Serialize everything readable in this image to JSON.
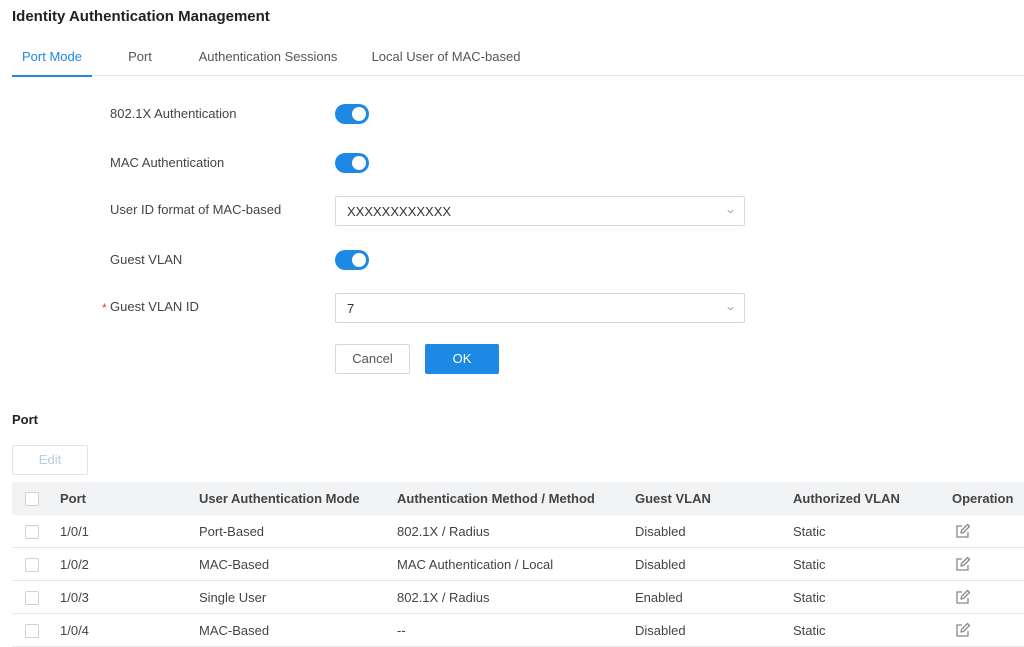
{
  "page": {
    "title": "Identity Authentication Management"
  },
  "tabs": [
    {
      "label": "Port Mode",
      "active": true
    },
    {
      "label": "Port"
    },
    {
      "label": "Authentication Sessions"
    },
    {
      "label": "Local User of MAC-based"
    }
  ],
  "form": {
    "dot1x": {
      "label": "802.1X Authentication",
      "enabled": true
    },
    "mac_auth": {
      "label": "MAC Authentication",
      "enabled": true
    },
    "user_id_format": {
      "label": "User ID format of MAC-based",
      "value": "XXXXXXXXXXXX"
    },
    "guest_vlan": {
      "label": "Guest VLAN",
      "enabled": true
    },
    "guest_vlan_id": {
      "label": "Guest VLAN ID",
      "required_mark": "*",
      "value": "7"
    },
    "cancel_label": "Cancel",
    "ok_label": "OK"
  },
  "port_section": {
    "title": "Port",
    "edit_label": "Edit",
    "columns": [
      "Port",
      "User Authentication Mode",
      "Authentication Method / Method",
      "Guest VLAN",
      "Authorized VLAN",
      "Operation"
    ],
    "rows": [
      {
        "port": "1/0/1",
        "mode": "Port-Based",
        "method": "802.1X / Radius",
        "guest_vlan": "Disabled",
        "authorized_vlan": "Static"
      },
      {
        "port": "1/0/2",
        "mode": "MAC-Based",
        "method": "MAC Authentication / Local",
        "guest_vlan": "Disabled",
        "authorized_vlan": "Static"
      },
      {
        "port": "1/0/3",
        "mode": "Single User",
        "method": "802.1X / Radius",
        "guest_vlan": "Enabled",
        "authorized_vlan": "Static"
      },
      {
        "port": "1/0/4",
        "mode": "MAC-Based",
        "method": "--",
        "guest_vlan": "Disabled",
        "authorized_vlan": "Static"
      }
    ]
  },
  "colors": {
    "accent": "#1e88e5",
    "required": "#e53935"
  }
}
